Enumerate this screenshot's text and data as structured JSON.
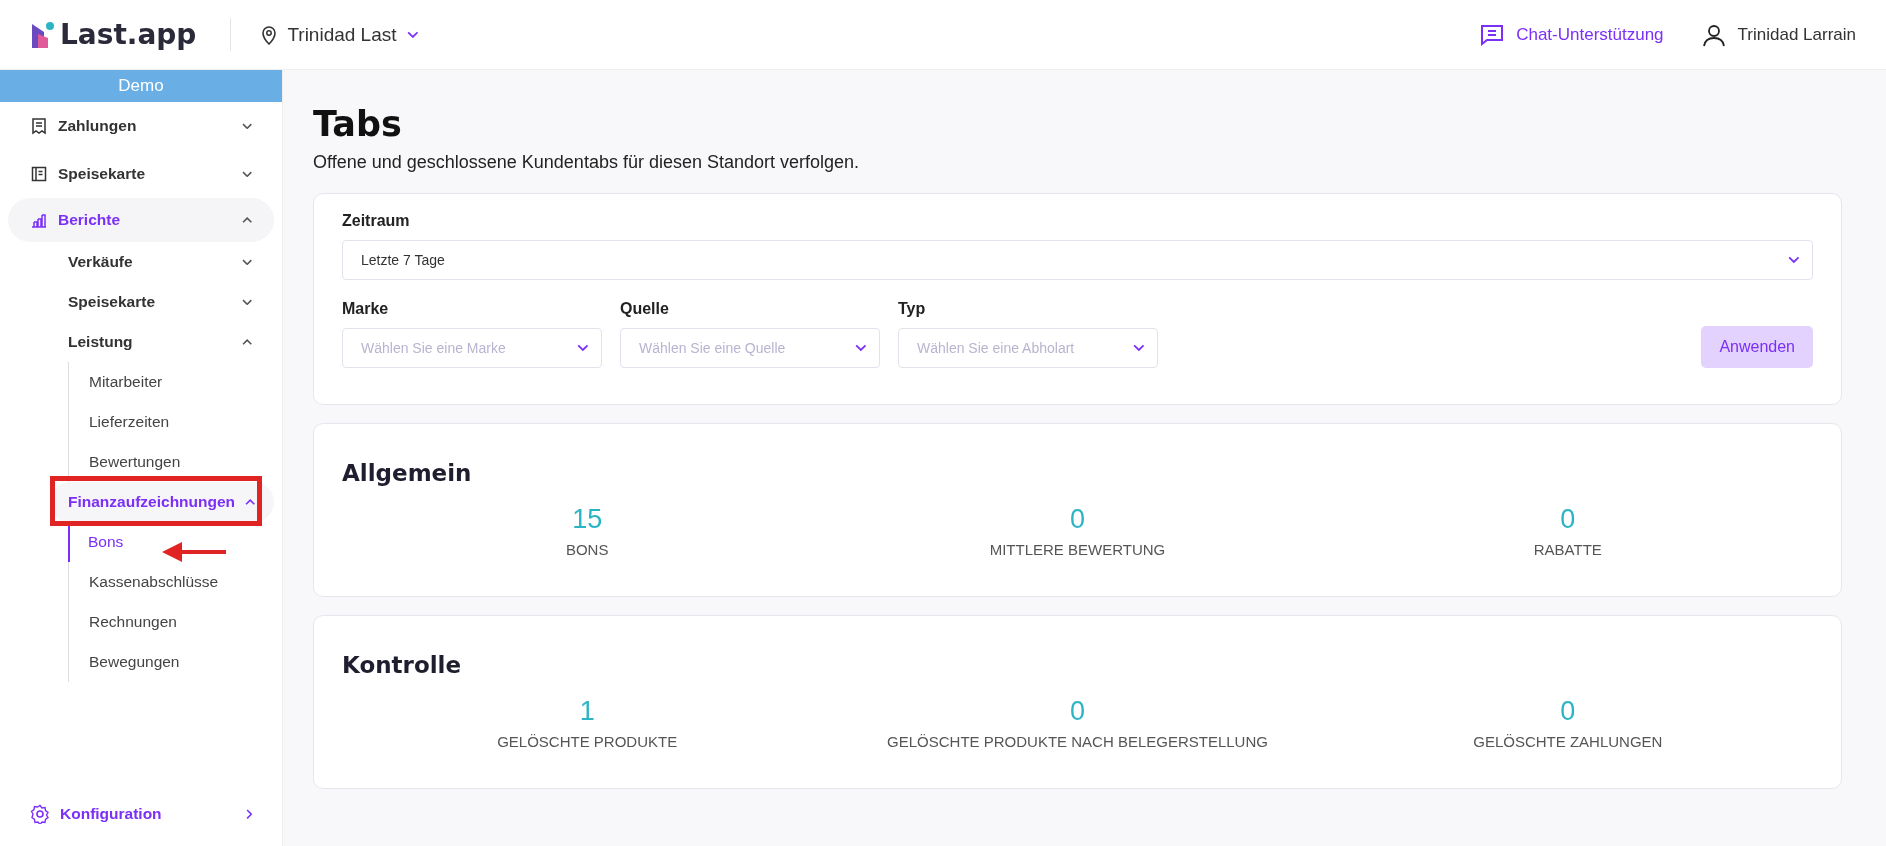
{
  "header": {
    "logo": "Last.app",
    "location": "Trinidad Last",
    "support": "Chat-Unterstützung",
    "user": "Trinidad Larrain"
  },
  "sidebar": {
    "banner": "Demo",
    "items": [
      {
        "label": "Zahlungen",
        "kind": "group",
        "expanded": false,
        "selected": false
      },
      {
        "label": "Speisekarte",
        "kind": "group",
        "expanded": false,
        "selected": false
      },
      {
        "label": "Berichte",
        "kind": "group",
        "expanded": true,
        "selected": true,
        "children": [
          {
            "label": "Verkäufe",
            "expanded": false,
            "selected": false
          },
          {
            "label": "Speisekarte",
            "expanded": false,
            "selected": false
          },
          {
            "label": "Leistung",
            "expanded": true,
            "selected": false,
            "children": [
              {
                "label": "Mitarbeiter",
                "selected": false
              },
              {
                "label": "Lieferzeiten",
                "selected": false
              },
              {
                "label": "Bewertungen",
                "selected": false
              }
            ]
          },
          {
            "label": "Finanzaufzeichnungen",
            "expanded": true,
            "selected": true,
            "children": [
              {
                "label": "Bons",
                "selected": true
              },
              {
                "label": "Kassenabschlüsse",
                "selected": false
              },
              {
                "label": "Rechnungen",
                "selected": false
              },
              {
                "label": "Bewegungen",
                "selected": false
              }
            ]
          }
        ]
      },
      {
        "label": "Konfiguration",
        "kind": "link",
        "selected": false
      }
    ]
  },
  "page": {
    "title": "Tabs",
    "subtitle": "Offene und geschlossene Kundentabs für diesen Standort verfolgen."
  },
  "filters": {
    "period": {
      "label": "Zeitraum",
      "value": "Letzte 7 Tage"
    },
    "selects": [
      {
        "label": "Marke",
        "placeholder": "Wählen Sie eine Marke"
      },
      {
        "label": "Quelle",
        "placeholder": "Wählen Sie eine Quelle"
      },
      {
        "label": "Typ",
        "placeholder": "Wählen Sie eine Abholart"
      }
    ],
    "apply": "Anwenden"
  },
  "sections": [
    {
      "title": "Allgemein",
      "stats": [
        {
          "value": "15",
          "label": "BONS"
        },
        {
          "value": "0",
          "label": "MITTLERE BEWERTUNG"
        },
        {
          "value": "0",
          "label": "RABATTE"
        }
      ]
    },
    {
      "title": "Kontrolle",
      "stats": [
        {
          "value": "1",
          "label": "GELÖSCHTE PRODUKTE"
        },
        {
          "value": "0",
          "label": "GELÖSCHTE PRODUKTE NACH BELEGERSTELLUNG"
        },
        {
          "value": "0",
          "label": "GELÖSCHTE ZAHLUNGEN"
        }
      ]
    }
  ]
}
